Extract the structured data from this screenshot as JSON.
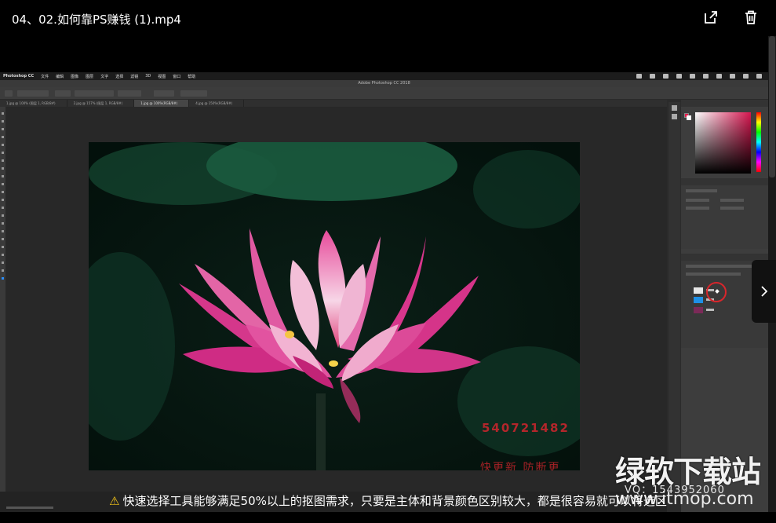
{
  "viewer": {
    "title": "04、02.如何靠PS赚钱 (1).mp4",
    "share_icon": "share-out-icon",
    "delete_icon": "trash-icon",
    "next_icon": "chevron-right-icon"
  },
  "photoshop": {
    "window_title": "Adobe Photoshop CC 2018",
    "menu": [
      "Photoshop CC",
      "文件",
      "编辑",
      "图像",
      "图层",
      "文字",
      "选择",
      "滤镜",
      "3D",
      "视图",
      "窗口",
      "帮助"
    ],
    "tabs": [
      "1.jpg @ 100% (图层 1, RGB/8#)",
      "2.jpg @ 157% (图层 1, RGB/8#)",
      "1.jpg @ 100%(RGB/8#)",
      "4.jpg @ 150%(RGB/8#)"
    ]
  },
  "image_watermarks": {
    "qq_number": "540721482",
    "slogan": "快更新 防断更"
  },
  "subtitle": {
    "warning_icon": "warning-icon",
    "text": "快速选择工具能够满足50%以上的抠图需求，只要是主体和背景颜色区别较大，都是很容易就可以将选区"
  },
  "site_watermark": {
    "name": "绿软下载站",
    "vq": "VQ：1543952060",
    "url": "www.itmop.com"
  },
  "colors": {
    "accent_red": "#d8262c",
    "lotus_pink": "#e0407a",
    "warning_yellow": "#f5c518"
  }
}
